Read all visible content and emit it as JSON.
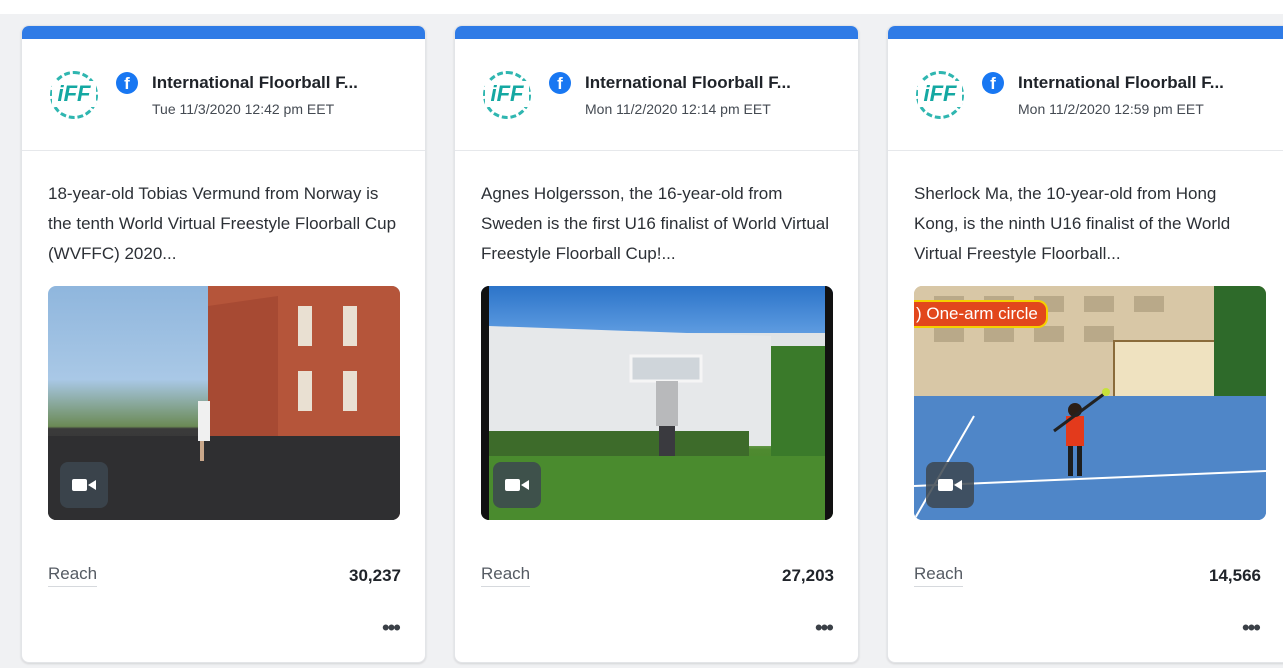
{
  "cards": [
    {
      "page_name": "International Floorball F...",
      "logo_text": "iFF",
      "date": "Tue 11/3/2020 12:42 pm EET",
      "body": "18-year-old Tobias Vermund from Norway is the tenth World Virtual Freestyle Floorball Cup (WVFFC) 2020...",
      "media_overlay": "",
      "stat_label": "Reach",
      "stat_value": "30,237",
      "more_label": "•••"
    },
    {
      "page_name": "International Floorball F...",
      "logo_text": "iFF",
      "date": "Mon 11/2/2020 12:14 pm EET",
      "body": "Agnes Holgersson, the 16-year-old from Sweden is the first U16 finalist of World Virtual Freestyle Floorball Cup!...",
      "media_overlay": "",
      "stat_label": "Reach",
      "stat_value": "27,203",
      "more_label": "•••"
    },
    {
      "page_name": "International Floorball F...",
      "logo_text": "iFF",
      "date": "Mon 11/2/2020 12:59 pm EET",
      "body": "Sherlock Ma, the 10-year-old from Hong Kong, is the ninth U16 finalist of the World Virtual Freestyle Floorball...",
      "media_overlay": ") One-arm circle",
      "stat_label": "Reach",
      "stat_value": "14,566",
      "more_label": "•••"
    }
  ],
  "colors": {
    "accent": "#2f7be6",
    "facebook": "#1877f2",
    "logo": "#14a8a2"
  },
  "icons": [
    "facebook-icon",
    "video-camera-icon",
    "more-options-icon"
  ]
}
